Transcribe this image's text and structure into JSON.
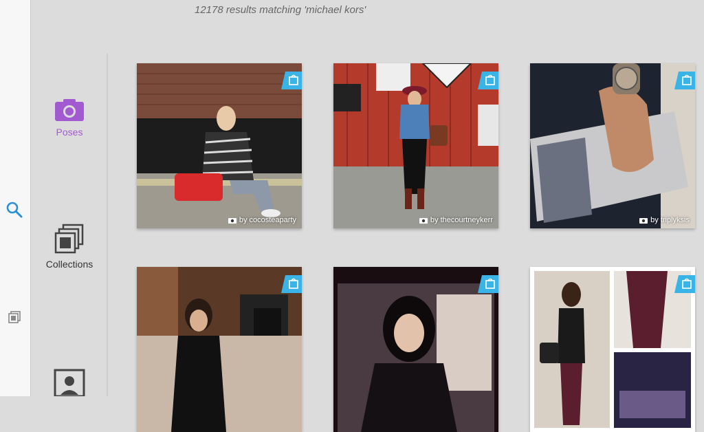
{
  "search": {
    "results_text": "12178 results matching 'michael kors'"
  },
  "sidebar": {
    "icons": [
      "search-icon",
      "collections-icon"
    ]
  },
  "nav": {
    "poses_label": "Poses",
    "collections_label": "Collections"
  },
  "colors": {
    "accent_purple": "#a25ad0",
    "shop_badge": "#3ab3e6",
    "search_blue": "#2a8fd6"
  },
  "grid": {
    "cards": [
      {
        "credit": "by cocosteaparty"
      },
      {
        "credit": "by thecourtneykerr"
      },
      {
        "credit": "by triplyksis"
      },
      {
        "credit": ""
      },
      {
        "credit": ""
      },
      {
        "credit": ""
      }
    ]
  }
}
